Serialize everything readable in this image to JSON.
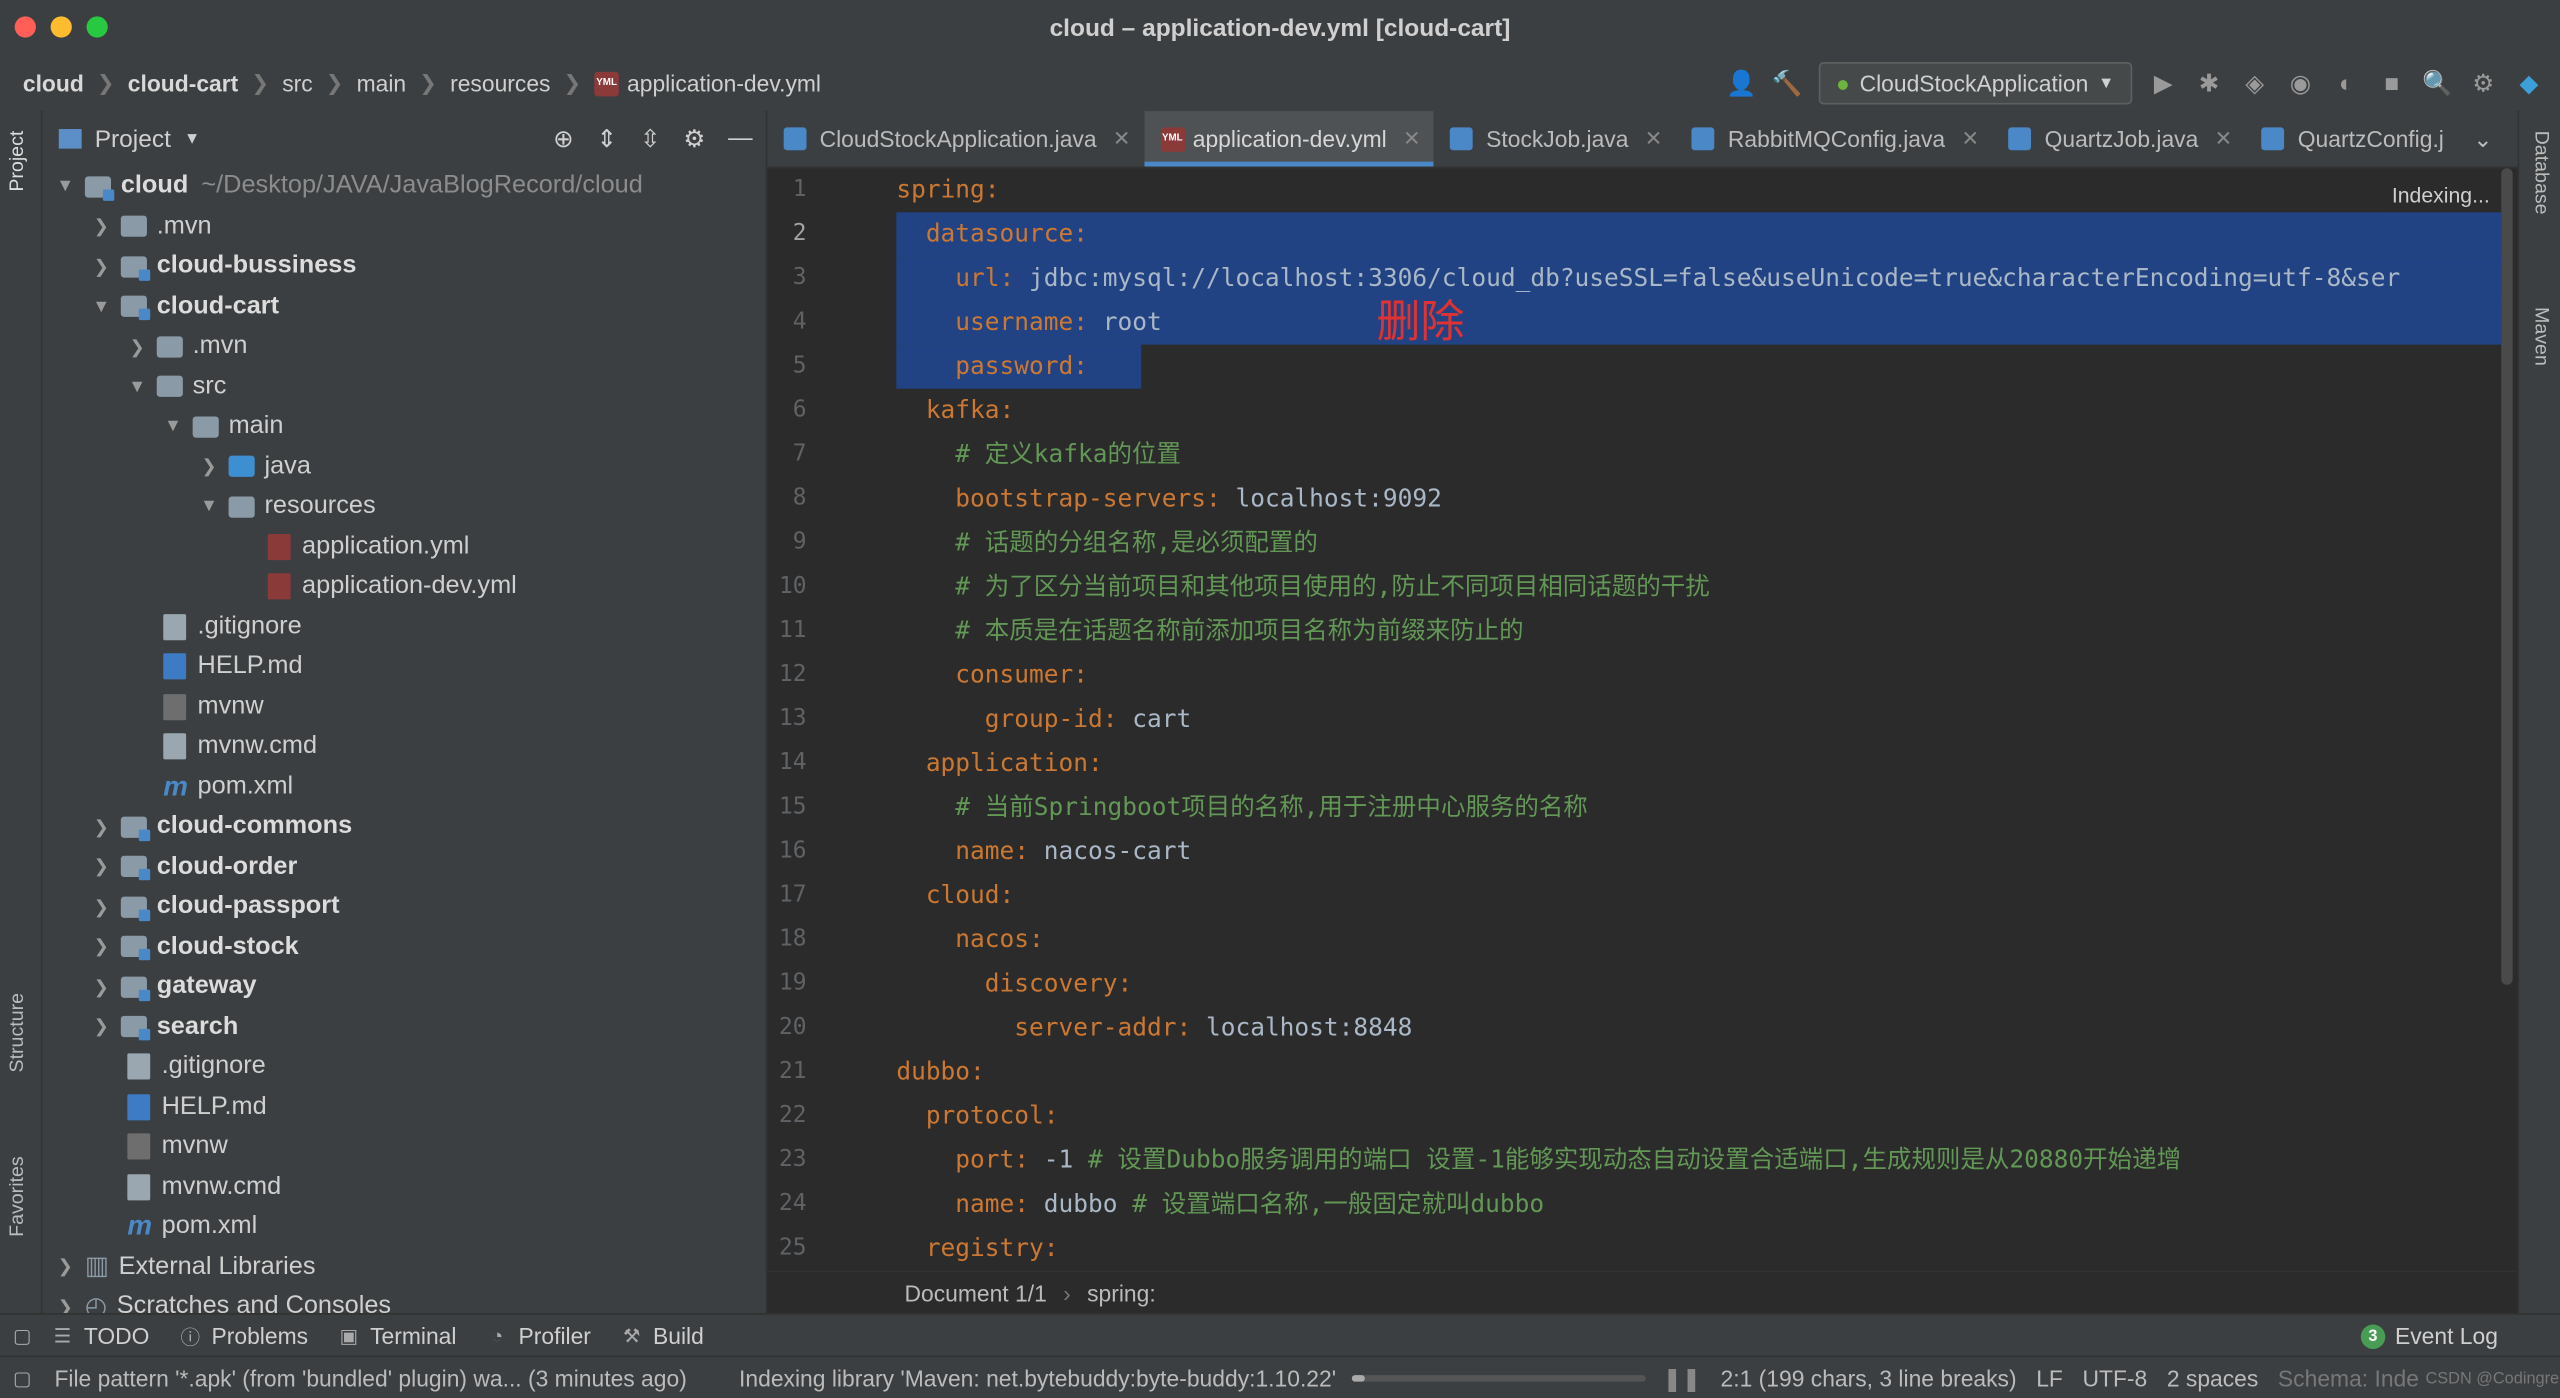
{
  "window": {
    "title": "cloud – application-dev.yml [cloud-cart]"
  },
  "breadcrumb": [
    "cloud",
    "cloud-cart",
    "src",
    "main",
    "resources",
    "application-dev.yml"
  ],
  "toolbar": {
    "run_config": "CloudStockApplication"
  },
  "left_strip": {
    "project": "Project",
    "structure": "Structure",
    "favorites": "Favorites"
  },
  "right_strip": {
    "database": "Database",
    "maven": "Maven"
  },
  "project_panel": {
    "title": "Project",
    "tree": [
      {
        "label": "cloud",
        "path": "~/Desktop/JAVA/JavaBlogRecord/cloud",
        "bold": true
      },
      {
        "label": ".mvn"
      },
      {
        "label": "cloud-bussiness",
        "bold": true
      },
      {
        "label": "cloud-cart",
        "bold": true
      },
      {
        "label": ".mvn"
      },
      {
        "label": "src"
      },
      {
        "label": "main"
      },
      {
        "label": "java"
      },
      {
        "label": "resources"
      },
      {
        "label": "application.yml"
      },
      {
        "label": "application-dev.yml"
      },
      {
        "label": ".gitignore"
      },
      {
        "label": "HELP.md"
      },
      {
        "label": "mvnw"
      },
      {
        "label": "mvnw.cmd"
      },
      {
        "label": "pom.xml"
      },
      {
        "label": "cloud-commons",
        "bold": true
      },
      {
        "label": "cloud-order",
        "bold": true
      },
      {
        "label": "cloud-passport",
        "bold": true
      },
      {
        "label": "cloud-stock",
        "bold": true
      },
      {
        "label": "gateway",
        "bold": true
      },
      {
        "label": "search",
        "bold": true
      },
      {
        "label": ".gitignore"
      },
      {
        "label": "HELP.md"
      },
      {
        "label": "mvnw"
      },
      {
        "label": "mvnw.cmd"
      },
      {
        "label": "pom.xml"
      },
      {
        "label": "External Libraries"
      },
      {
        "label": "Scratches and Consoles"
      }
    ]
  },
  "tabs": [
    {
      "label": "CloudStockApplication.java"
    },
    {
      "label": "application-dev.yml",
      "active": true
    },
    {
      "label": "StockJob.java"
    },
    {
      "label": "RabbitMQConfig.java"
    },
    {
      "label": "QuartzJob.java"
    },
    {
      "label": "QuartzConfig.j"
    }
  ],
  "editor": {
    "indexing": "Indexing...",
    "annotation": "删除",
    "line_numbers": [
      "1",
      "2",
      "3",
      "4",
      "5",
      "6",
      "7",
      "8",
      "9",
      "10",
      "11",
      "12",
      "13",
      "14",
      "15",
      "16",
      "17",
      "18",
      "19",
      "20",
      "21",
      "22",
      "23",
      "24",
      "25"
    ],
    "lines": [
      {
        "indent": "",
        "key": "spring",
        "rest": ""
      },
      {
        "indent": "  ",
        "key": "datasource",
        "rest": ""
      },
      {
        "indent": "    ",
        "key": "url",
        "rest": " jdbc:mysql://localhost:3306/cloud_db?useSSL=false&useUnicode=true&characterEncoding=utf-8&ser"
      },
      {
        "indent": "    ",
        "key": "username",
        "rest": " root"
      },
      {
        "indent": "    ",
        "key": "password",
        "rest": " "
      },
      {
        "indent": "  ",
        "key": "kafka",
        "rest": ""
      },
      {
        "indent": "    ",
        "comment": "# 定义kafka的位置"
      },
      {
        "indent": "    ",
        "key": "bootstrap-servers",
        "rest": " localhost:9092"
      },
      {
        "indent": "    ",
        "comment": "# 话题的分组名称,是必须配置的"
      },
      {
        "indent": "    ",
        "comment": "# 为了区分当前项目和其他项目使用的,防止不同项目相同话题的干扰"
      },
      {
        "indent": "    ",
        "comment": "# 本质是在话题名称前添加项目名称为前缀来防止的"
      },
      {
        "indent": "    ",
        "key": "consumer",
        "rest": ""
      },
      {
        "indent": "      ",
        "key": "group-id",
        "rest": " cart"
      },
      {
        "indent": "  ",
        "key": "application",
        "rest": ""
      },
      {
        "indent": "    ",
        "comment": "# 当前Springboot项目的名称,用于注册中心服务的名称"
      },
      {
        "indent": "    ",
        "key": "name",
        "rest": " nacos-cart"
      },
      {
        "indent": "  ",
        "key": "cloud",
        "rest": ""
      },
      {
        "indent": "    ",
        "key": "nacos",
        "rest": ""
      },
      {
        "indent": "      ",
        "key": "discovery",
        "rest": ""
      },
      {
        "indent": "        ",
        "key": "server-addr",
        "rest": " localhost:8848"
      },
      {
        "indent": "",
        "key": "dubbo",
        "rest": ""
      },
      {
        "indent": "  ",
        "key": "protocol",
        "rest": ""
      },
      {
        "indent": "    ",
        "key": "port",
        "rest": " -1 ",
        "comment": "# 设置Dubbo服务调用的端口 设置-1能够实现动态自动设置合适端口,生成规则是从20880开始递增"
      },
      {
        "indent": "    ",
        "key": "name",
        "rest": " dubbo ",
        "comment": "# 设置端口名称,一般固定就叫dubbo"
      },
      {
        "indent": "  ",
        "key": "registry",
        "rest": ""
      }
    ],
    "crumb_doc": "Document 1/1",
    "crumb_path": "spring:"
  },
  "tool_windows": [
    {
      "label": "TODO",
      "icon": "list-icon"
    },
    {
      "label": "Problems",
      "icon": "problems-icon"
    },
    {
      "label": "Terminal",
      "icon": "terminal-icon"
    },
    {
      "label": "Profiler",
      "icon": "profiler-icon"
    },
    {
      "label": "Build",
      "icon": "hammer-icon"
    }
  ],
  "event_log": {
    "count": "3",
    "label": "Event Log"
  },
  "status": {
    "message": "File pattern '*.apk' (from 'bundled' plugin) wa... (3 minutes ago)",
    "indexing": "Indexing library 'Maven: net.bytebuddy:byte-buddy:1.10.22'",
    "position": "2:1 (199 chars, 3 line breaks)",
    "line_sep": "LF",
    "encoding": "UTF-8",
    "indent": "2 spaces",
    "schema": "Schema: Inde",
    "watermark": "CSDN @Codingre"
  }
}
